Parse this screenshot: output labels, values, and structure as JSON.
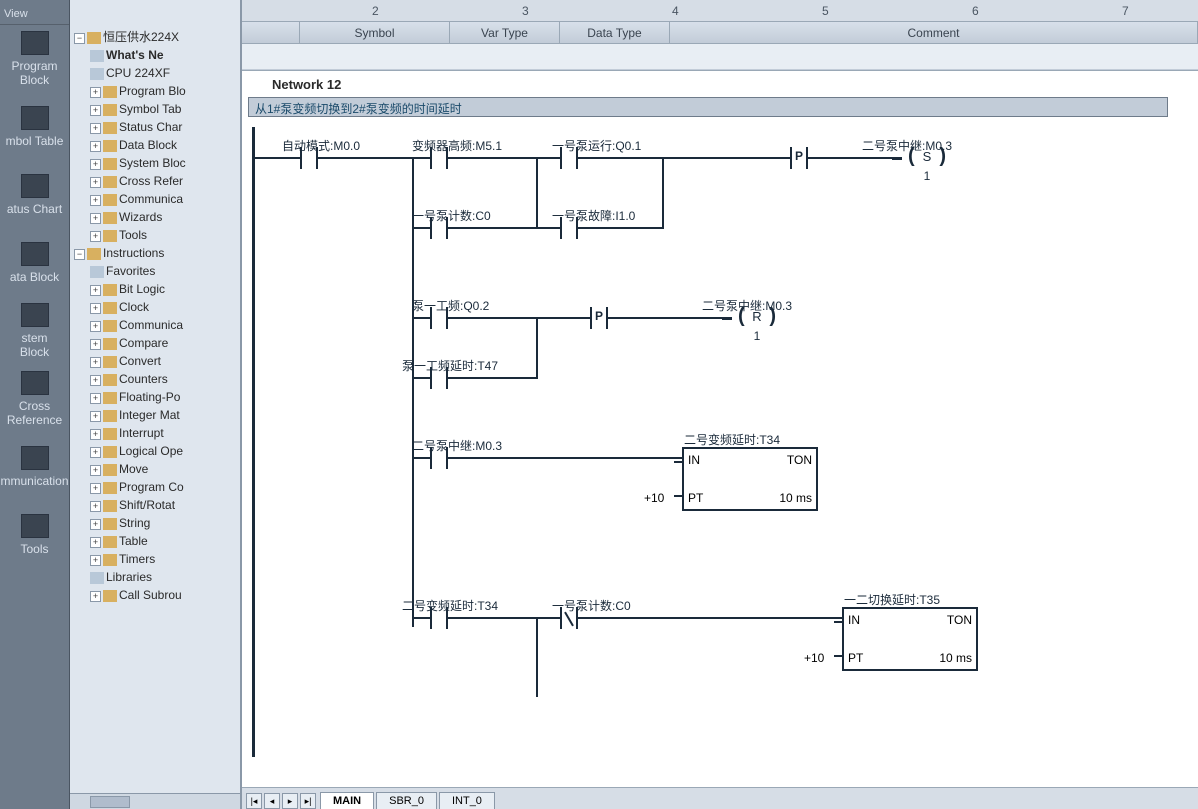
{
  "palette": {
    "head": "View",
    "items": [
      "Program\nBlock",
      "mbol Table",
      "atus Chart",
      "ata Block",
      "stem Block",
      "Cross\nReference",
      "mmunication",
      "Tools"
    ]
  },
  "tree": {
    "root": "恒压供水224X",
    "whats_new": "What's Ne",
    "cpu": "CPU 224XF",
    "nodes": [
      "Program Blo",
      "Symbol Tab",
      "Status Char",
      "Data Block",
      "System Bloc",
      "Cross Refer",
      "Communica",
      "Wizards",
      "Tools"
    ],
    "instructions": "Instructions",
    "instr_nodes": [
      "Favorites",
      "Bit Logic",
      "Clock",
      "Communica",
      "Compare",
      "Convert",
      "Counters",
      "Floating-Po",
      "Integer Mat",
      "Interrupt",
      "Logical Ope",
      "Move",
      "Program Co",
      "Shift/Rotat",
      "String",
      "Table",
      "Timers",
      "Libraries",
      "Call Subrou"
    ]
  },
  "ruler": {
    "marks": [
      "2",
      "3",
      "4",
      "5",
      "6",
      "7"
    ]
  },
  "columns": {
    "symbol": "Symbol",
    "vartype": "Var Type",
    "datatype": "Data Type",
    "comment": "Comment"
  },
  "network": {
    "title": "Network 12",
    "comment": "从1#泵变频切换到2#泵变频的时间延时"
  },
  "ladder": {
    "r1": {
      "c1": "自动模式:M0.0",
      "c2": "变频器高频:M5.1",
      "c3": "一号泵运行:Q0.1",
      "p": "P",
      "coil": "二号泵中继:M0.3",
      "coil_type": "S",
      "coil_sub": "1"
    },
    "r1b": {
      "c2": "一号泵计数:C0",
      "c3": "一号泵故障:I1.0"
    },
    "r2": {
      "c2": "泵一工频:Q0.2",
      "p": "P",
      "coil": "二号泵中继:M0.3",
      "coil_type": "R",
      "coil_sub": "1"
    },
    "r2b": {
      "c2": "泵一工频延时:T47"
    },
    "r3": {
      "c2": "二号泵中继:M0.3",
      "box_label": "二号变频延时:T34",
      "in": "IN",
      "ton": "TON",
      "pt": "PT",
      "ptv": "10 ms",
      "ext": "+10"
    },
    "r4": {
      "c2": "二号变频延时:T34",
      "c3": "一号泵计数:C0",
      "box_label": "一二切换延时:T35",
      "in": "IN",
      "ton": "TON",
      "pt": "PT",
      "ptv": "10 ms",
      "ext": "+10"
    }
  },
  "tabs": {
    "main": "MAIN",
    "sbr": "SBR_0",
    "int": "INT_0"
  }
}
